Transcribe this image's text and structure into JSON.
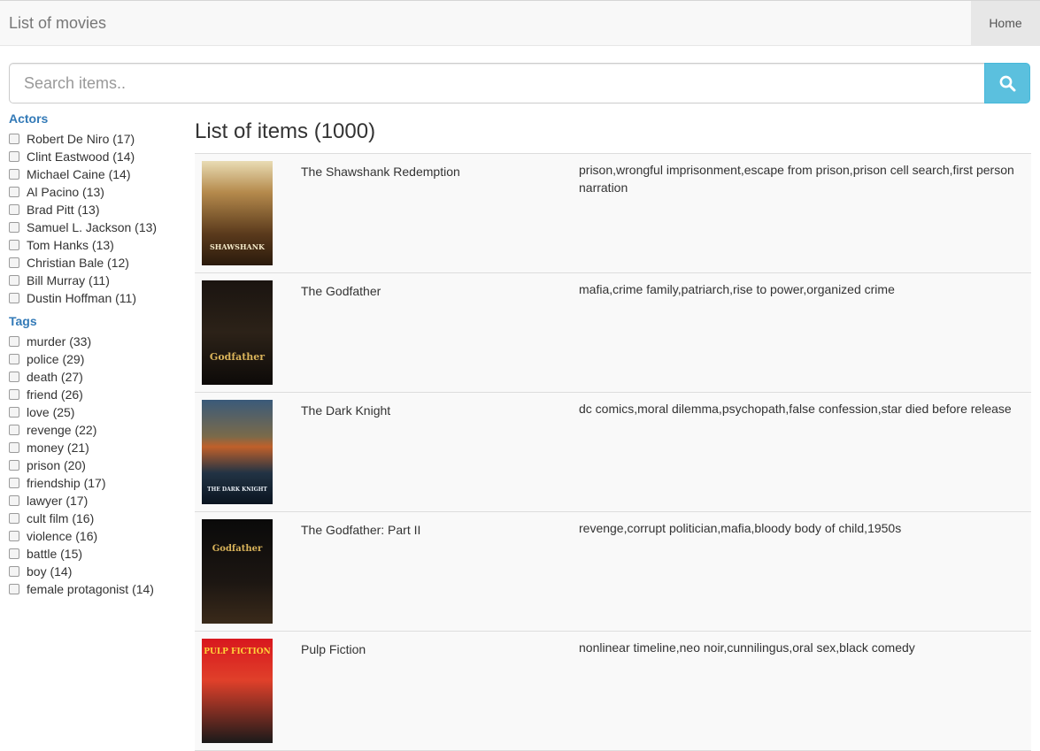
{
  "navbar": {
    "brand": "List of movies",
    "home": "Home"
  },
  "search": {
    "placeholder": "Search items.."
  },
  "sidebar": {
    "actors_title": "Actors",
    "actors": [
      "Robert De Niro (17)",
      "Clint Eastwood (14)",
      "Michael Caine (14)",
      "Al Pacino (13)",
      "Brad Pitt (13)",
      "Samuel L. Jackson (13)",
      "Tom Hanks (13)",
      "Christian Bale (12)",
      "Bill Murray (11)",
      "Dustin Hoffman (11)"
    ],
    "tags_title": "Tags",
    "tags": [
      "murder (33)",
      "police (29)",
      "death (27)",
      "friend (26)",
      "love (25)",
      "revenge (22)",
      "money (21)",
      "prison (20)",
      "friendship (17)",
      "lawyer (17)",
      "cult film (16)",
      "violence (16)",
      "battle (15)",
      "boy (14)",
      "female protagonist (14)"
    ]
  },
  "main": {
    "heading": "List of items (1000)",
    "items": [
      {
        "title": "The Shawshank Redemption",
        "tags": "prison,wrongful imprisonment,escape from prison,prison cell search,first person narration",
        "poster_text": "SHAWSHANK"
      },
      {
        "title": "The Godfather",
        "tags": "mafia,crime family,patriarch,rise to power,organized crime",
        "poster_text": "Godfather"
      },
      {
        "title": "The Dark Knight",
        "tags": "dc comics,moral dilemma,psychopath,false confession,star died before release",
        "poster_text": "THE DARK KNIGHT"
      },
      {
        "title": "The Godfather: Part II",
        "tags": "revenge,corrupt politician,mafia,bloody body of child,1950s",
        "poster_text": "Godfather"
      },
      {
        "title": "Pulp Fiction",
        "tags": "nonlinear timeline,neo noir,cunnilingus,oral sex,black comedy",
        "poster_text": "PULP FICTION"
      }
    ]
  },
  "colors": {
    "accent": "#337ab7",
    "search_button": "#5bc0de",
    "navbar_bg": "#f8f8f8"
  }
}
